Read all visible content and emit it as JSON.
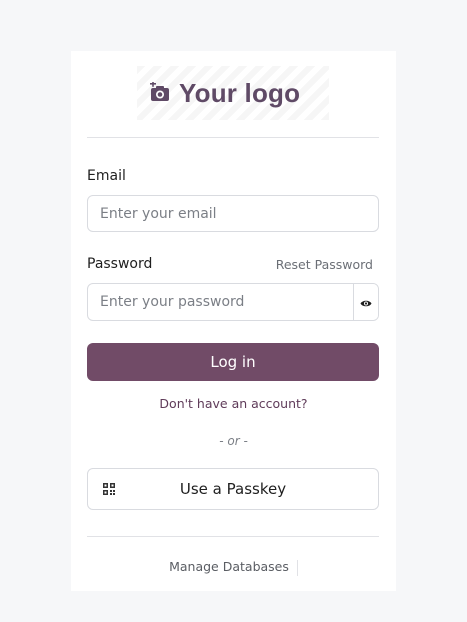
{
  "brand": {
    "logo_text": "Your logo",
    "logo_icon": "camera-plus-icon",
    "color": "#714b67"
  },
  "form": {
    "email_label": "Email",
    "email_placeholder": "Enter your email",
    "password_label": "Password",
    "reset_password_label": "Reset Password",
    "password_placeholder": "Enter your password",
    "show_password_icon": "eye-icon",
    "login_label": "Log in",
    "signup_label": "Don't have an account?",
    "or_separator": "- or -",
    "passkey_label": "Use a Passkey",
    "passkey_icon": "qr-code-icon"
  },
  "footer": {
    "manage_databases_label": "Manage Databases"
  }
}
